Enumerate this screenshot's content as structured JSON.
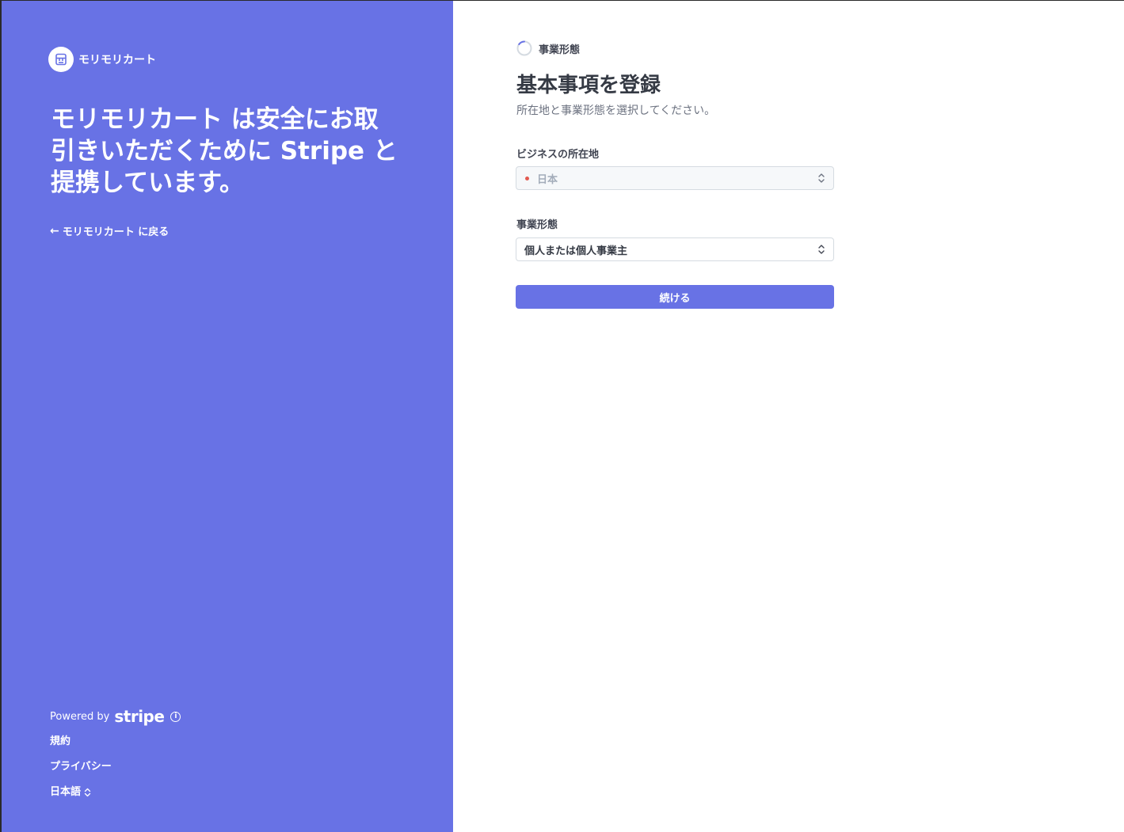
{
  "brand": {
    "name": "モリモリカート",
    "headline": "モリモリカート は安全にお取引きいただくために Stripe と提携しています。",
    "back_link": "モリモリカート に戻る"
  },
  "footer": {
    "powered_by": "Powered by",
    "stripe": "stripe",
    "terms": "規約",
    "privacy": "プライバシー",
    "language": "日本語"
  },
  "step": {
    "label": "事業形態"
  },
  "form": {
    "title": "基本事項を登録",
    "subtitle": "所在地と事業形態を選択してください。",
    "location_label": "ビジネスの所在地",
    "location_value": "日本",
    "business_type_label": "事業形態",
    "business_type_value": "個人または個人事業主",
    "continue_label": "続ける"
  },
  "colors": {
    "accent": "#6872e5",
    "text_primary": "#353a44",
    "text_secondary": "#6c7280"
  }
}
